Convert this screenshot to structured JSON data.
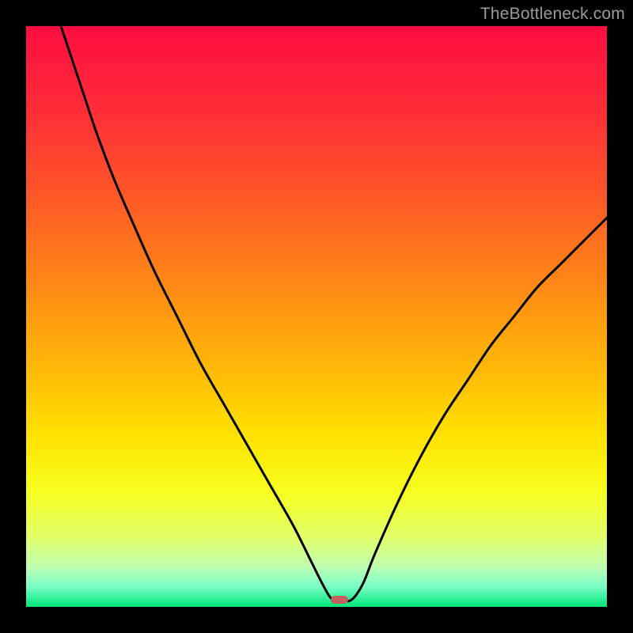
{
  "watermark": "TheBottleneck.com",
  "chart_data": {
    "type": "line",
    "title": "",
    "xlabel": "",
    "ylabel": "",
    "xlim": [
      0,
      100
    ],
    "ylim": [
      0,
      100
    ],
    "grid": false,
    "legend": false,
    "annotations": [],
    "background_gradient": {
      "direction": "vertical_top_to_bottom",
      "stops": [
        {
          "pos": 0.0,
          "color": "#ff0d41"
        },
        {
          "pos": 0.15,
          "color": "#ff2e37"
        },
        {
          "pos": 0.3,
          "color": "#ff5a26"
        },
        {
          "pos": 0.45,
          "color": "#ff8a15"
        },
        {
          "pos": 0.58,
          "color": "#ffb508"
        },
        {
          "pos": 0.7,
          "color": "#ffe000"
        },
        {
          "pos": 0.8,
          "color": "#f7ff1e"
        },
        {
          "pos": 0.88,
          "color": "#e2ff6a"
        },
        {
          "pos": 0.93,
          "color": "#c0ffb0"
        },
        {
          "pos": 0.965,
          "color": "#7affc8"
        },
        {
          "pos": 1.0,
          "color": "#00e676"
        }
      ]
    },
    "series": [
      {
        "name": "bottleneck-curve",
        "color": "#000000",
        "x": [
          6,
          8,
          10,
          12,
          15,
          18,
          22,
          26,
          30,
          34,
          38,
          42,
          46,
          49,
          51,
          52.5,
          54,
          56,
          58,
          60,
          64,
          68,
          72,
          76,
          80,
          84,
          88,
          92,
          96,
          100
        ],
        "y": [
          100,
          94,
          88,
          82,
          74,
          67,
          58,
          50,
          42,
          35,
          28,
          21,
          14,
          8,
          4,
          1.5,
          1.2,
          1.2,
          4,
          9,
          18,
          26,
          33,
          39,
          45,
          50,
          55,
          59,
          63,
          67
        ]
      }
    ],
    "marker": {
      "name": "optimal-point",
      "x": 54,
      "y": 1.2,
      "color": "#c86060"
    }
  }
}
